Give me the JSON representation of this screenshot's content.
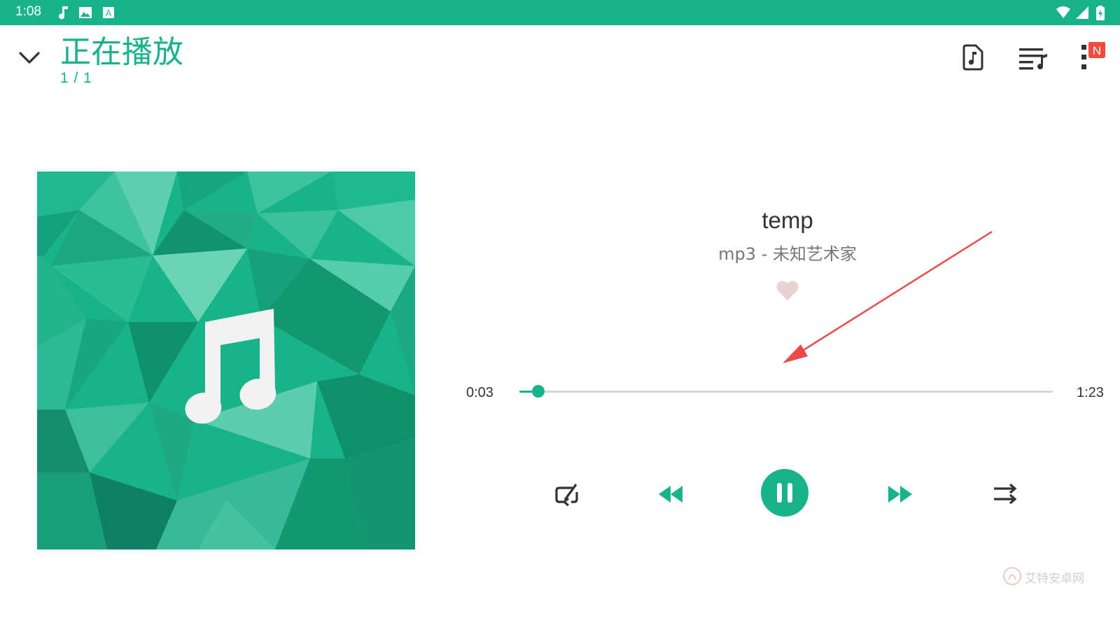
{
  "status_bar": {
    "time": "1:08",
    "icons": [
      "music-note-icon",
      "image-icon",
      "a-box-icon",
      "wifi-icon",
      "signal-icon",
      "battery-icon"
    ]
  },
  "header": {
    "title": "正在播放",
    "queue_position": "1 / 1",
    "actions": [
      "song-file-icon",
      "playlist-music-icon",
      "more-vert-icon"
    ],
    "badge": "N"
  },
  "track": {
    "title": "temp",
    "subtitle": "mp3 - 未知艺术家",
    "liked": false
  },
  "playback": {
    "current_time": "0:03",
    "total_time": "1:23",
    "progress_fraction": 0.036
  },
  "controls": [
    "repeat-icon",
    "rewind-icon",
    "pause-icon",
    "fast-forward-icon",
    "shuffle-icon"
  ],
  "watermark": "艾特安卓网",
  "colors": {
    "accent": "#18b38a",
    "annotation_arrow": "#ea4a4a",
    "heart": "#e8d2d2"
  }
}
